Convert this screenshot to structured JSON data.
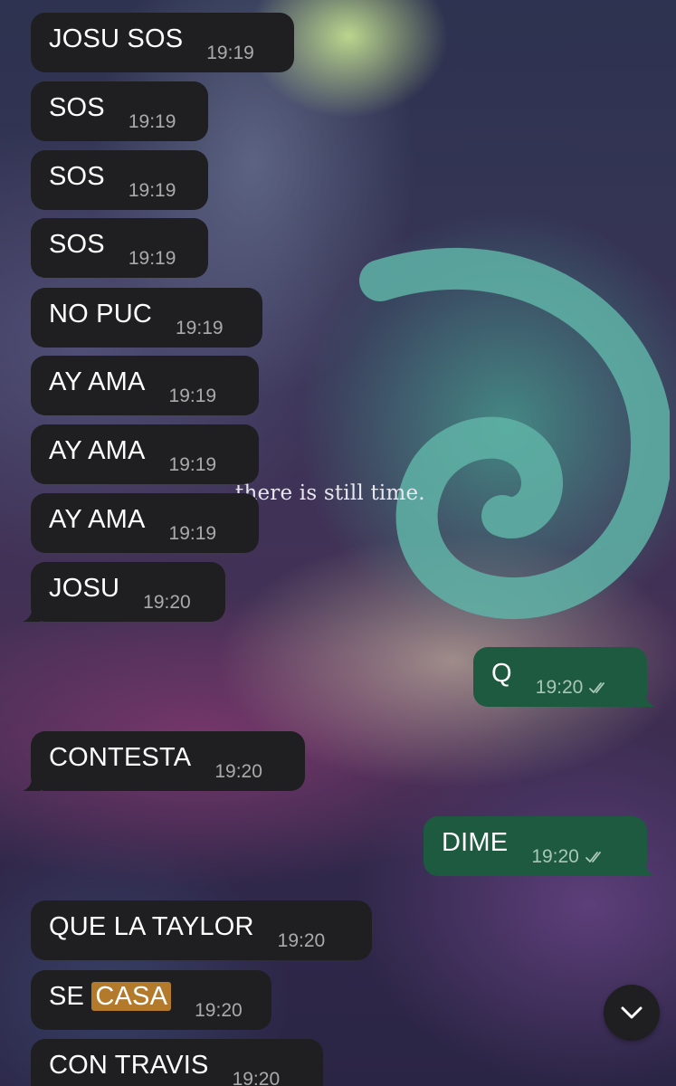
{
  "wallpaper": {
    "caption": "there is still time."
  },
  "messages": [
    {
      "text": "JOSU SOS",
      "time": "19:19",
      "direction": "in"
    },
    {
      "text": "SOS",
      "time": "19:19",
      "direction": "in"
    },
    {
      "text": "SOS",
      "time": "19:19",
      "direction": "in"
    },
    {
      "text": "SOS",
      "time": "19:19",
      "direction": "in"
    },
    {
      "text": "NO PUC",
      "time": "19:19",
      "direction": "in"
    },
    {
      "text": "AY AMA",
      "time": "19:19",
      "direction": "in"
    },
    {
      "text": "AY AMA",
      "time": "19:19",
      "direction": "in"
    },
    {
      "text": "AY AMA",
      "time": "19:19",
      "direction": "in"
    },
    {
      "text": "JOSU",
      "time": "19:20",
      "direction": "in"
    },
    {
      "text": "Q",
      "time": "19:20",
      "direction": "out",
      "status": "read"
    },
    {
      "text": "CONTESTA",
      "time": "19:20",
      "direction": "in"
    },
    {
      "text": "DIME",
      "time": "19:20",
      "direction": "out",
      "status": "read"
    },
    {
      "text": "QUE LA TAYLOR",
      "time": "19:20",
      "direction": "in"
    },
    {
      "text_prefix": "SE ",
      "text_highlight": "CASA",
      "time": "19:20",
      "direction": "in"
    },
    {
      "text": "CON TRAVIS",
      "time": "19:20",
      "direction": "in"
    }
  ],
  "controls": {
    "scroll_down_icon": "chevron-down-icon"
  },
  "colors": {
    "incoming_bubble": "#1f1f21",
    "outgoing_bubble": "#1e5a40",
    "highlight": "#b27a2a"
  }
}
